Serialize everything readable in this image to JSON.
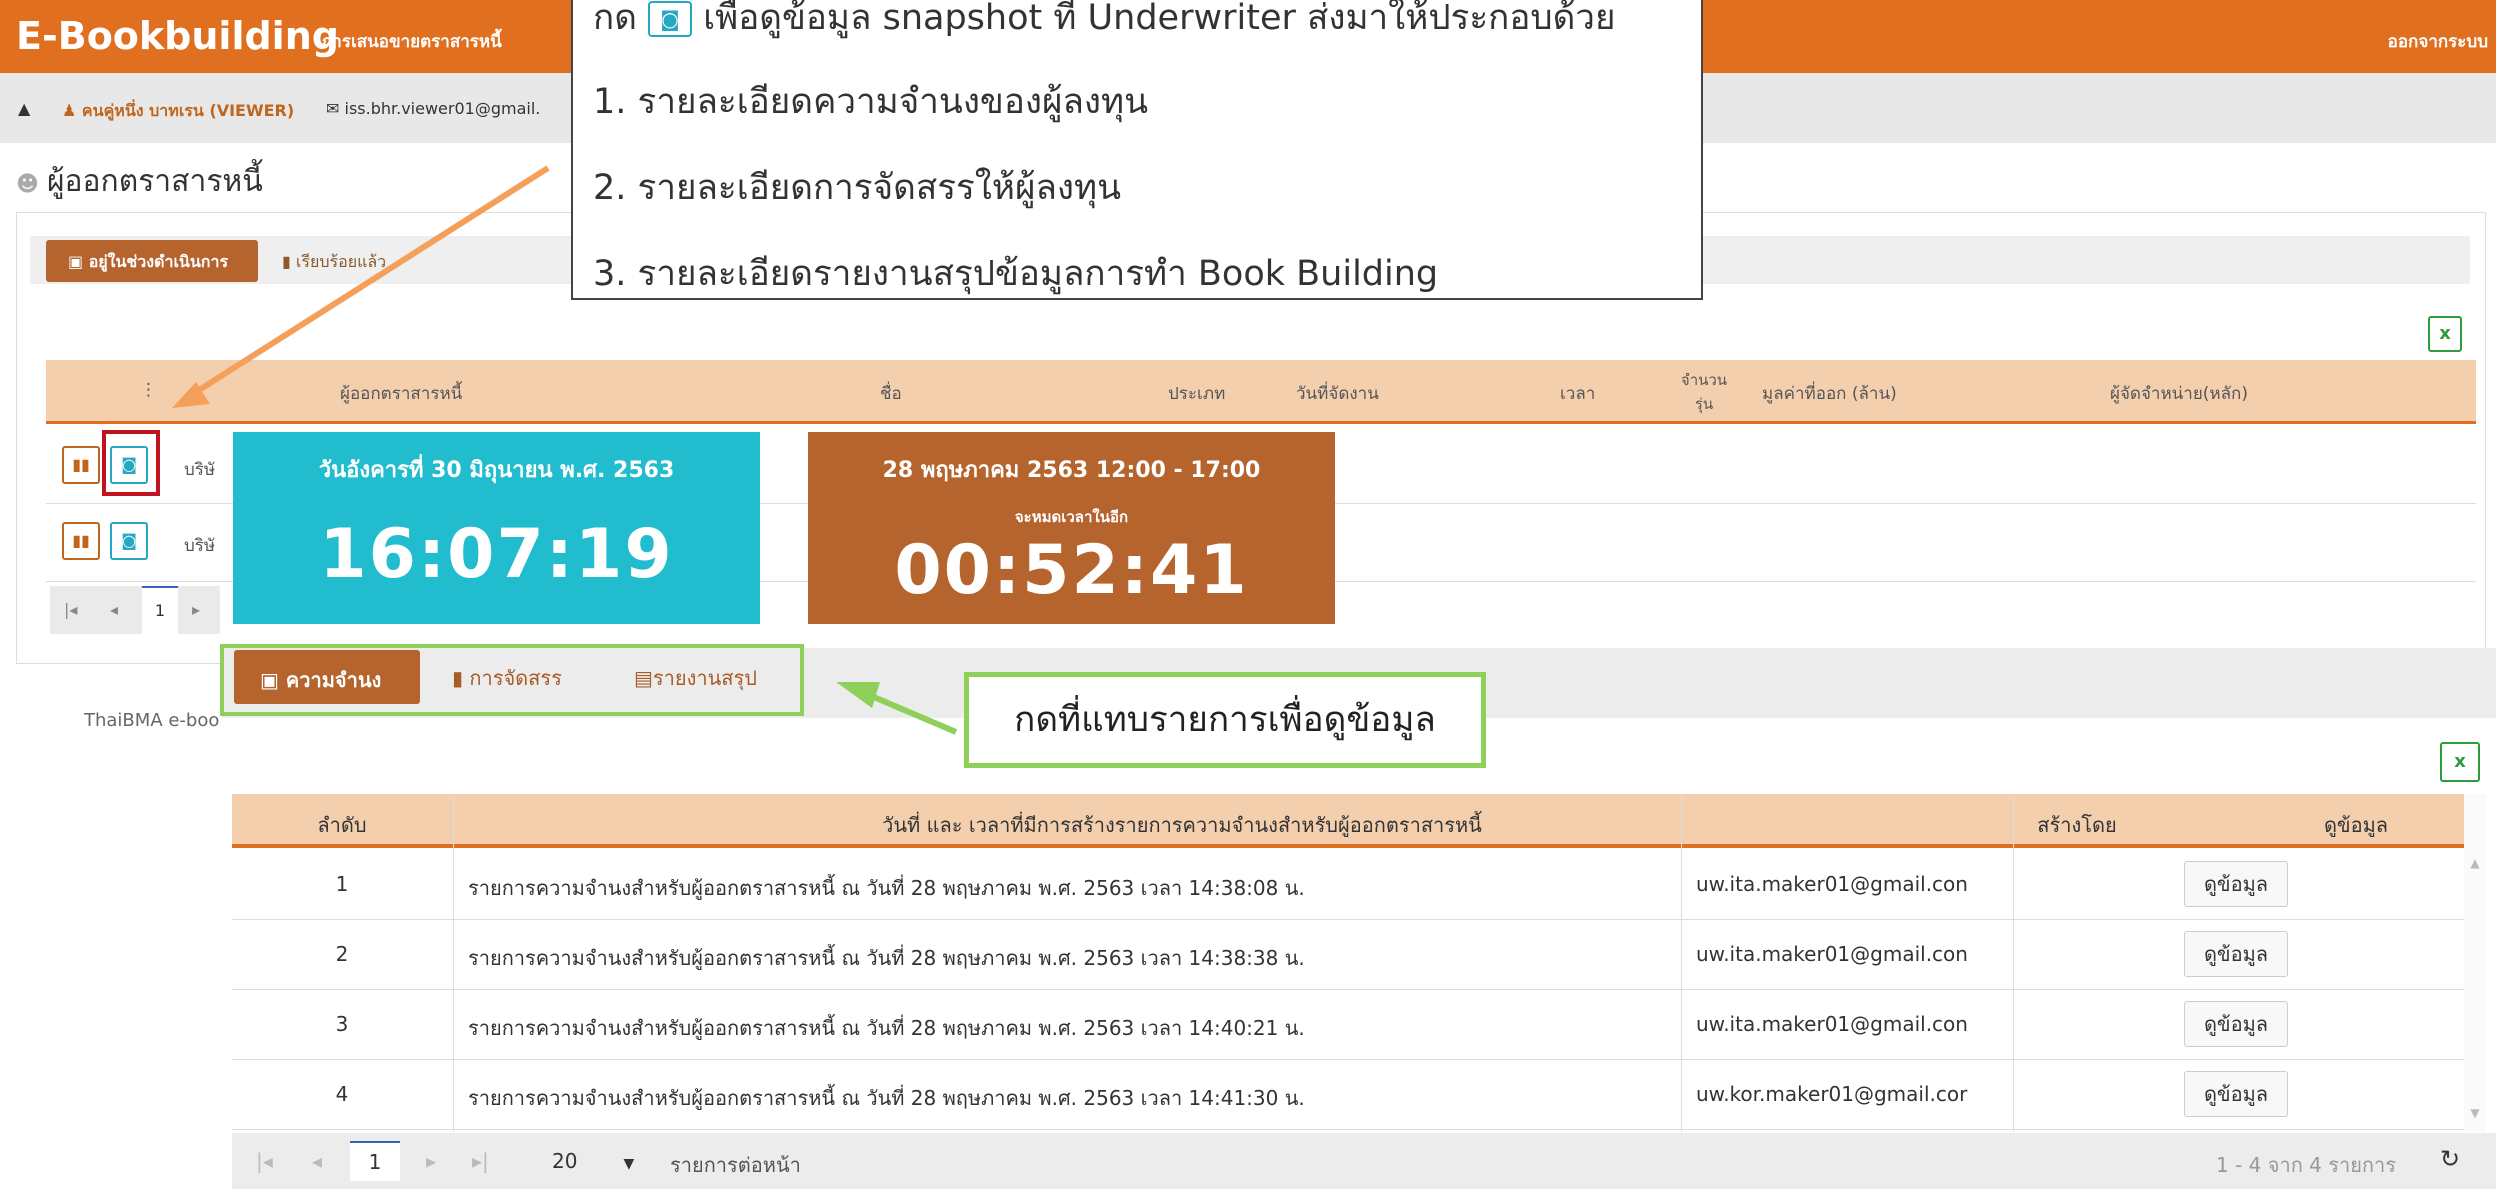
{
  "app": {
    "title": "E-Bookbuilding",
    "subtitle": "การเสนอขายตราสารหนี้",
    "logout": "ออกจากระบบ"
  },
  "userbar": {
    "bell_icon": "bell-icon",
    "name": "คนคู่หนึ่ง บาทเรน (VIEWER)",
    "email": "iss.bhr.viewer01@gmail."
  },
  "page": {
    "heading": "ผู้ออกตราสารหนี้",
    "status_tabs": [
      "อยู่ในช่วงดำเนินการ",
      "เรียบร้อยแล้ว"
    ]
  },
  "bg_table": {
    "headers": [
      "ผู้ออกตราสารหนี้",
      "ชื่อ",
      "ประเภท",
      "วันที่จัดงาน",
      "เวลา",
      "จำนวน รุ่น",
      "มูลค่าที่ออก (ล้าน)",
      "ผู้จัดจำหน่าย(หลัก)"
    ],
    "rows": [
      {
        "issuer": "บริษั"
      },
      {
        "issuer": "บริษั"
      }
    ],
    "page": "1",
    "footer": "ThaiBMA e-boo"
  },
  "tiles": {
    "date": "วันอังคารที่ 30 มิถุนายน พ.ศ. 2563",
    "clock": "16:07:19",
    "event_window": "28 พฤษภาคม 2563 12:00 - 17:00",
    "remaining_label": "จะหมดเวลาในอีก",
    "countdown": "00:52:41"
  },
  "tabs": [
    "ความจำนง",
    "การจัดสรร",
    "รายงานสรุป"
  ],
  "table": {
    "headers": [
      "ลำดับ",
      "วันที่ และ เวลาที่มีการสร้างรายการความจำนงสำหรับผู้ออกตราสารหนี้",
      "สร้างโดย",
      "ดูข้อมูล"
    ],
    "rows": [
      {
        "no": "1",
        "desc": "รายการความจำนงสำหรับผู้ออกตราสารหนี้ ณ วันที่ 28 พฤษภาคม พ.ศ. 2563 เวลา 14:38:08 น.",
        "by": "uw.ita.maker01@gmail.con",
        "view": "ดูข้อมูล"
      },
      {
        "no": "2",
        "desc": "รายการความจำนงสำหรับผู้ออกตราสารหนี้ ณ วันที่ 28 พฤษภาคม พ.ศ. 2563 เวลา 14:38:38 น.",
        "by": "uw.ita.maker01@gmail.con",
        "view": "ดูข้อมูล"
      },
      {
        "no": "3",
        "desc": "รายการความจำนงสำหรับผู้ออกตราสารหนี้ ณ วันที่ 28 พฤษภาคม พ.ศ. 2563 เวลา 14:40:21 น.",
        "by": "uw.ita.maker01@gmail.con",
        "view": "ดูข้อมูล"
      },
      {
        "no": "4",
        "desc": "รายการความจำนงสำหรับผู้ออกตราสารหนี้ ณ วันที่ 28 พฤษภาคม พ.ศ. 2563 เวลา 14:41:30 น.",
        "by": "uw.kor.maker01@gmail.cor",
        "view": "ดูข้อมูล"
      }
    ]
  },
  "pager": {
    "current_page": "1",
    "page_size": "20",
    "per_page_label": "รายการต่อหน้า",
    "summary": "1 - 4 จาก 4 รายการ"
  },
  "callout": {
    "line0_prefix": "กด",
    "line0_suffix": "เพื่อดูข้อมูล snapshot ที่ Underwriter ส่งมาให้ประกอบด้วย",
    "line1": "1. รายละเอียดความจำนงของผู้ลงทุน",
    "line2": "2. รายละเอียดการจัดสรรให้ผู้ลงทุน",
    "line3": "3. รายละเอียดรายงานสรุปข้อมูลการทำ Book Building"
  },
  "tab_hint": "กดที่แทบรายการเพื่อดูข้อมูล",
  "colors": {
    "brand_orange": "#e0701f",
    "tab_brown": "#b5642d",
    "clock_cyan": "#22bccf",
    "annotation_green": "#8fd05a",
    "annotation_orange": "#f5a05a",
    "highlight_red": "#c1121f"
  }
}
